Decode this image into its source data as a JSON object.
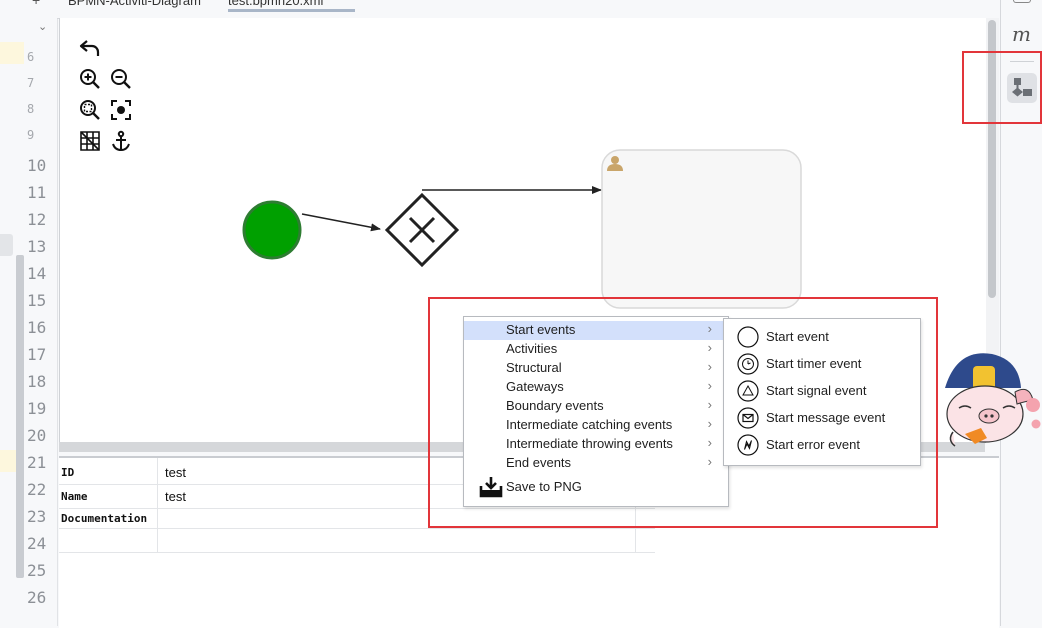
{
  "tabs": [
    {
      "label": "BPMN-Activiti-Diagram"
    },
    {
      "label": "test.bpmn20.xml"
    }
  ],
  "gutter": {
    "line_numbers": [
      "10",
      "11",
      "12",
      "13",
      "14",
      "15",
      "16",
      "17",
      "18",
      "19",
      "20",
      "21",
      "22",
      "23",
      "24",
      "25",
      "26"
    ]
  },
  "right_strip": {
    "m_label": "m"
  },
  "diagram": {
    "start_event": {
      "color": "#00a000",
      "stroke": "#2e7d32"
    },
    "gateway": {
      "type": "exclusive"
    },
    "user_task": {
      "icon": "user-icon",
      "icon_color": "#c9a56a"
    }
  },
  "properties": {
    "rows": [
      {
        "key": "ID",
        "value": "test"
      },
      {
        "key": "Name",
        "value": "test"
      },
      {
        "key": "Documentation",
        "value": ""
      }
    ]
  },
  "context_menu": {
    "items": [
      {
        "label": "Start events",
        "has_submenu": true,
        "selected": true
      },
      {
        "label": "Activities",
        "has_submenu": true
      },
      {
        "label": "Structural",
        "has_submenu": true
      },
      {
        "label": "Gateways",
        "has_submenu": true
      },
      {
        "label": "Boundary events",
        "has_submenu": true
      },
      {
        "label": "Intermediate catching events",
        "has_submenu": true
      },
      {
        "label": "Intermediate throwing events",
        "has_submenu": true
      },
      {
        "label": "End events",
        "has_submenu": true
      }
    ],
    "save_label": "Save to PNG",
    "save_icon": "save-png-icon"
  },
  "submenu": {
    "items": [
      {
        "label": "Start event",
        "icon": "start-event-icon"
      },
      {
        "label": "Start timer event",
        "icon": "start-timer-event-icon"
      },
      {
        "label": "Start signal event",
        "icon": "start-signal-event-icon"
      },
      {
        "label": "Start message event",
        "icon": "start-message-event-icon"
      },
      {
        "label": "Start error event",
        "icon": "start-error-event-icon"
      }
    ]
  },
  "colors": {
    "highlight_box": "#e2353a",
    "menu_selection": "#d3e0fb"
  }
}
